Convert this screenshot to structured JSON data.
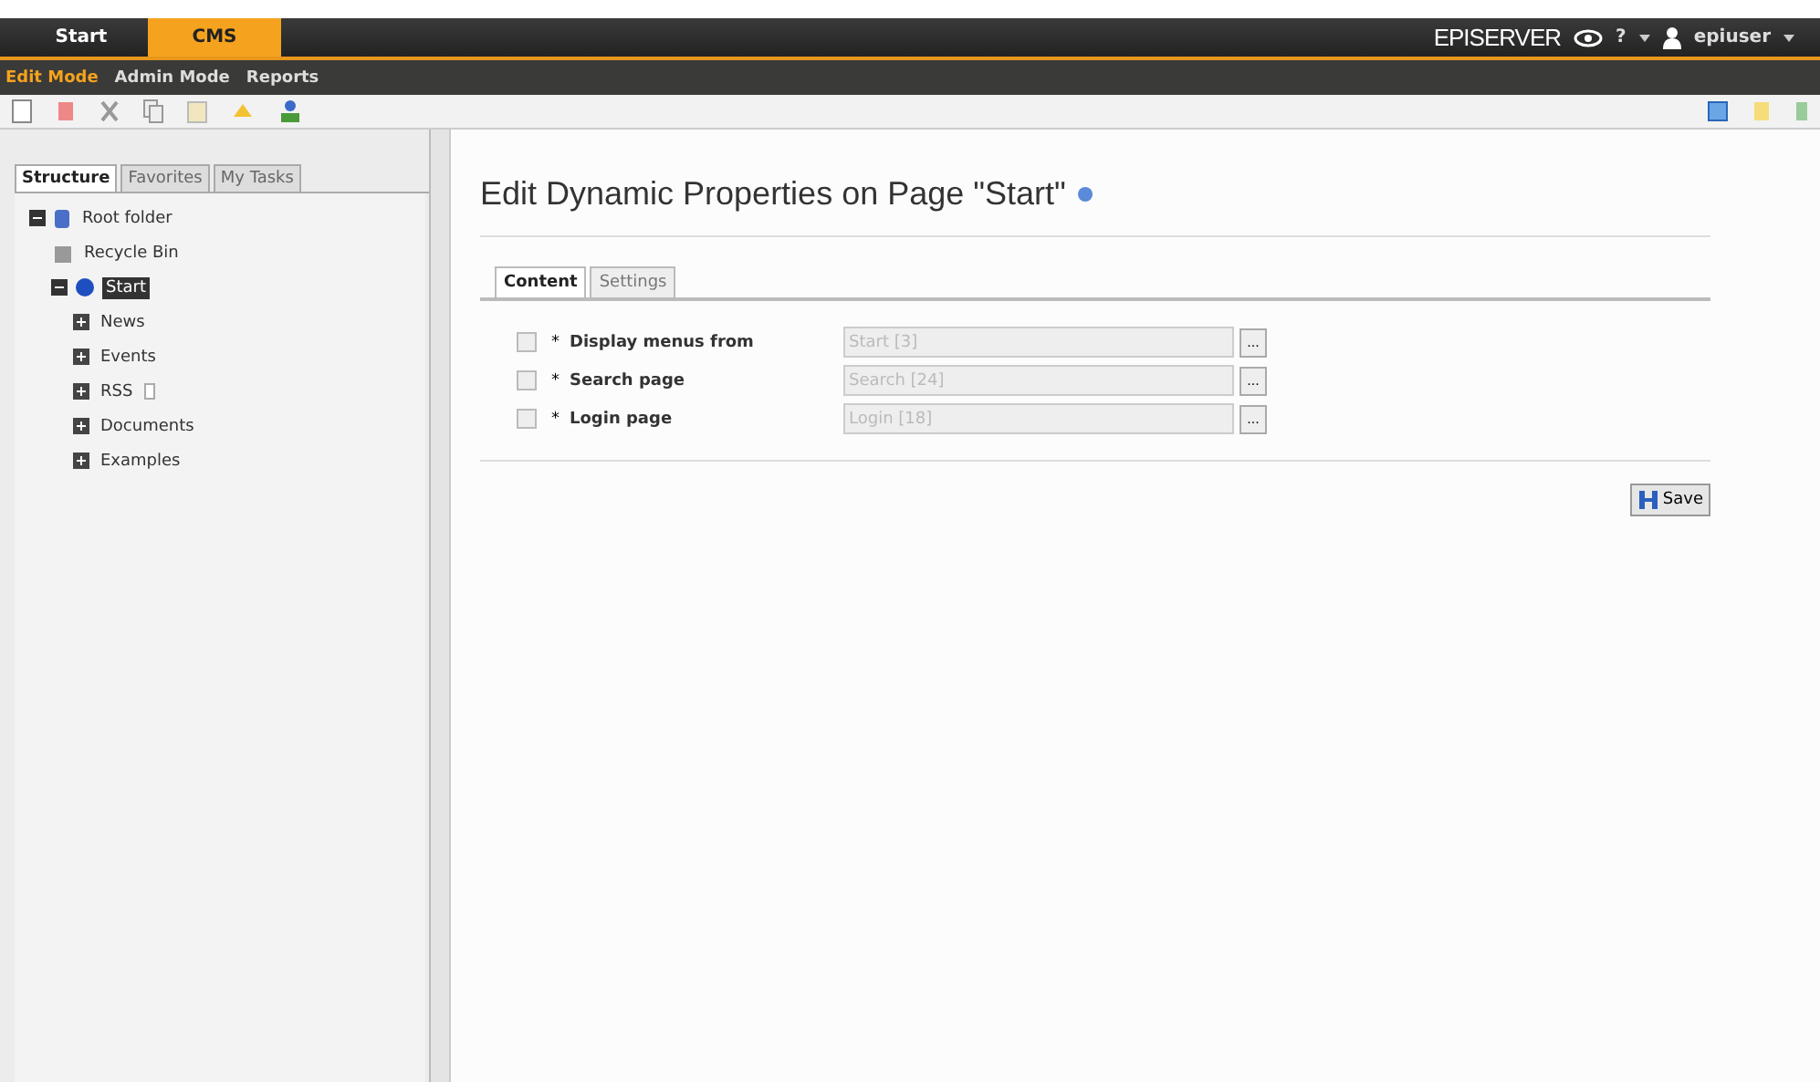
{
  "top_tabs": [
    {
      "label": "Start",
      "selected": false
    },
    {
      "label": "CMS",
      "selected": true
    }
  ],
  "brand": "EPISERVER",
  "help": "?",
  "user": "epiuser",
  "modes": [
    {
      "label": "Edit Mode",
      "selected": true
    },
    {
      "label": "Admin Mode",
      "selected": false
    },
    {
      "label": "Reports",
      "selected": false
    }
  ],
  "sidebar": {
    "tabs": [
      {
        "label": "Structure",
        "selected": true
      },
      {
        "label": "Favorites",
        "selected": false
      },
      {
        "label": "My Tasks",
        "selected": false
      }
    ],
    "tree": [
      {
        "label": "Root folder",
        "kind": "root",
        "expanded": true,
        "selected": false,
        "children": [
          {
            "label": "Recycle Bin",
            "kind": "bin",
            "selected": false
          },
          {
            "label": "Start",
            "kind": "globe",
            "expanded": true,
            "selected": true,
            "children": [
              {
                "label": "News",
                "expanded": false,
                "selected": false
              },
              {
                "label": "Events",
                "expanded": false,
                "selected": false
              },
              {
                "label": "RSS",
                "expanded": false,
                "selected": false,
                "note": true
              },
              {
                "label": "Documents",
                "expanded": false,
                "selected": false
              },
              {
                "label": "Examples",
                "expanded": false,
                "selected": false
              }
            ]
          }
        ]
      }
    ]
  },
  "main": {
    "title": "Edit Dynamic Properties on Page \"Start\"",
    "tabs": [
      {
        "label": "Content",
        "selected": true
      },
      {
        "label": "Settings",
        "selected": false
      }
    ],
    "properties": [
      {
        "label": "Display menus from",
        "required": "*",
        "checked": false,
        "value": "Start [3]"
      },
      {
        "label": "Search page",
        "required": "*",
        "checked": false,
        "value": "Search [24]"
      },
      {
        "label": "Login page",
        "required": "*",
        "checked": false,
        "value": "Login [18]"
      }
    ],
    "browse": "...",
    "save": "Save"
  }
}
